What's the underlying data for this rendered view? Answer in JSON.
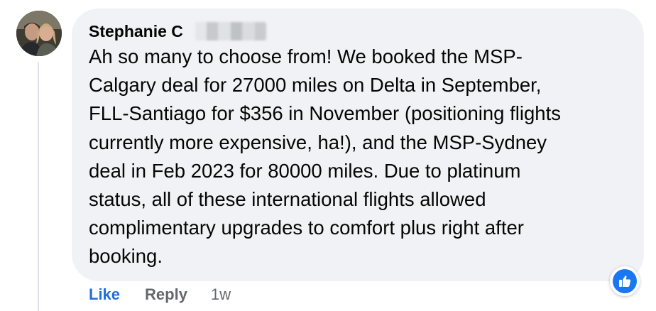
{
  "comment": {
    "author": "Stephanie C",
    "lines": [
      "Ah so many to choose from! We booked the MSP-",
      "Calgary deal for 27000 miles on Delta in September,",
      "FLL-Santiago for $356 in November (positioning flights",
      "currently more expensive, ha!), and the MSP-Sydney",
      "deal in Feb 2023 for 80000 miles. Due to platinum",
      "status, all of these international flights allowed",
      "complimentary upgrades to comfort plus right after",
      "booking."
    ],
    "reaction_icon": "thumbs-up-icon"
  },
  "actions": {
    "like_label": "Like",
    "reply_label": "Reply",
    "timestamp": "1w"
  },
  "colors": {
    "bubble": "#f0f2f5",
    "link_blue": "#216fdb",
    "secondary_text": "#65676b",
    "reaction_blue": "#1877f2"
  }
}
